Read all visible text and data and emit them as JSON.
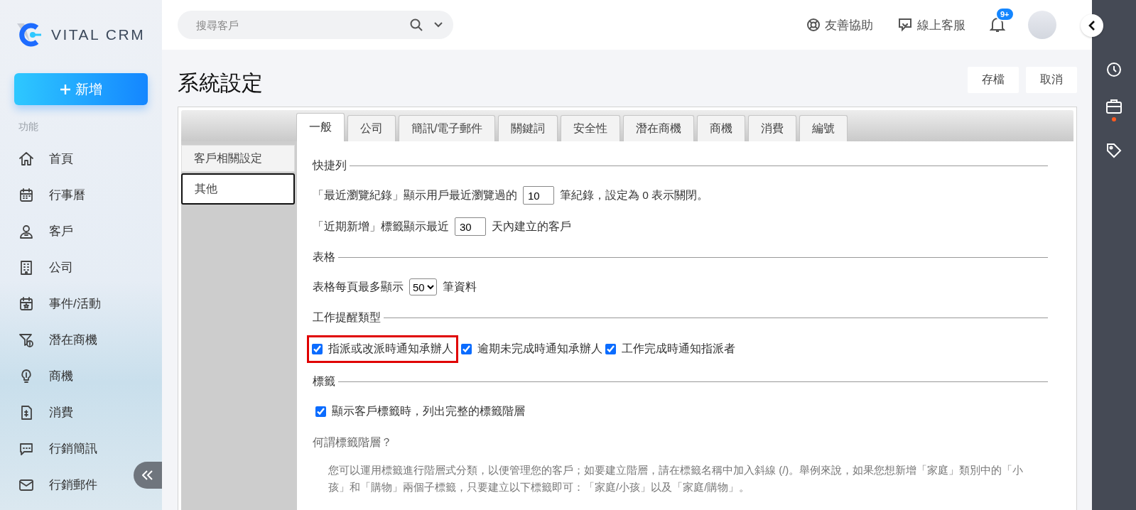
{
  "brand": {
    "name": "VITAL CRM"
  },
  "sidebar": {
    "new_button": "新增",
    "section_label": "功能",
    "items": [
      {
        "label": "首頁"
      },
      {
        "label": "行事曆"
      },
      {
        "label": "客戶"
      },
      {
        "label": "公司"
      },
      {
        "label": "事件/活動"
      },
      {
        "label": "潛在商機"
      },
      {
        "label": "商機"
      },
      {
        "label": "消費"
      },
      {
        "label": "行銷簡訊"
      },
      {
        "label": "行銷郵件"
      }
    ]
  },
  "topbar": {
    "search": {
      "placeholder": "搜尋客戶"
    },
    "links": [
      "友善協助",
      "線上客服"
    ],
    "notification_badge": "9+"
  },
  "page": {
    "title": "系統設定",
    "buttons": [
      "存檔",
      "取消"
    ]
  },
  "tabs": [
    {
      "label": "一般",
      "selected": true
    },
    {
      "label": "公司",
      "selected": false
    },
    {
      "label": "簡訊/電子郵件",
      "selected": false
    },
    {
      "label": "關鍵詞",
      "selected": false
    },
    {
      "label": "安全性",
      "selected": false
    },
    {
      "label": "潛在商機",
      "selected": false
    },
    {
      "label": "商機",
      "selected": false
    },
    {
      "label": "消費",
      "selected": false
    },
    {
      "label": "編號",
      "selected": false
    }
  ],
  "side_tabs": [
    {
      "label": "客戶相關設定",
      "selected": false
    },
    {
      "label": "其他",
      "selected": true
    }
  ],
  "sections": [
    {
      "title": "快捷列",
      "rows": [
        {
          "parts": [
            {
              "kind": "text",
              "text": "「最近瀏覽紀錄」顯示用戶最近瀏覽過的"
            },
            {
              "kind": "input",
              "value": "10"
            },
            {
              "kind": "text",
              "text": "筆紀錄，設定為 0 表示關閉。"
            }
          ]
        },
        {
          "parts": [
            {
              "kind": "text",
              "text": "「近期新增」標籤顯示最近"
            },
            {
              "kind": "input",
              "value": "30"
            },
            {
              "kind": "text",
              "text": "天內建立的客戶"
            }
          ]
        }
      ]
    },
    {
      "title": "表格",
      "rows": [
        {
          "parts": [
            {
              "kind": "text",
              "text": "表格每頁最多顯示"
            },
            {
              "kind": "select",
              "value": "50"
            },
            {
              "kind": "text",
              "text": "筆資料"
            }
          ]
        }
      ]
    },
    {
      "title": "工作提醒類型",
      "rows": [
        {
          "parts": [
            {
              "kind": "checkbox",
              "label": "指派或改派時通知承辦人",
              "checked": true,
              "highlighted": true
            },
            {
              "kind": "checkbox",
              "label": "逾期未完成時通知承辦人",
              "checked": true,
              "highlighted": false
            },
            {
              "kind": "checkbox",
              "label": "工作完成時通知指派者",
              "checked": true,
              "highlighted": false
            }
          ]
        }
      ]
    },
    {
      "title": "標籤",
      "rows": [
        {
          "parts": [
            {
              "kind": "checkbox",
              "label": "顯示客戶標籤時，列出完整的標籤階層",
              "checked": true,
              "highlighted": false
            }
          ]
        },
        {
          "parts": [
            {
              "kind": "question",
              "text": "何謂標籤階層？"
            }
          ]
        },
        {
          "parts": [
            {
              "kind": "note",
              "text": "您可以運用標籤進行階層式分類，以便管理您的客戶；如要建立階層，請在標籤名稱中加入斜線 (/)。舉例來說，如果您想新增「家庭」類別中的「小孩」和「購物」兩個子標籤，只要建立以下標籤即可：「家庭/小孩」以及「家庭/購物」。"
            }
          ]
        }
      ]
    }
  ]
}
